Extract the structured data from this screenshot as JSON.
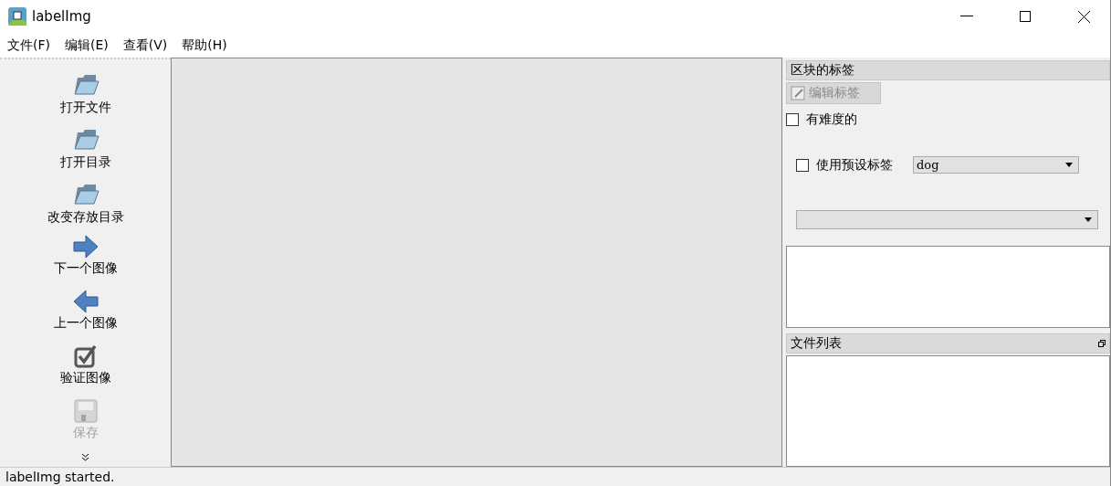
{
  "window": {
    "title": "labelImg"
  },
  "menu": [
    "文件(F)",
    "编辑(E)",
    "查看(V)",
    "帮助(H)"
  ],
  "toolbar": [
    {
      "kind": "folder",
      "label": "打开文件",
      "disabled": false
    },
    {
      "kind": "folder",
      "label": "打开目录",
      "disabled": false
    },
    {
      "kind": "folder",
      "label": "改变存放目录",
      "disabled": false
    },
    {
      "kind": "next",
      "label": "下一个图像",
      "disabled": false
    },
    {
      "kind": "prev",
      "label": "上一个图像",
      "disabled": false
    },
    {
      "kind": "verify",
      "label": "验证图像",
      "disabled": false
    },
    {
      "kind": "save",
      "label": "保存",
      "disabled": true
    }
  ],
  "box_labels": {
    "title": "区块的标签",
    "edit_button": {
      "label": "编辑标签",
      "disabled": true
    },
    "difficult": {
      "label": "有难度的",
      "checked": false
    },
    "default_label": {
      "label": "使用预设标签",
      "checked": false,
      "value": "dog"
    }
  },
  "file_list": {
    "title": "文件列表"
  },
  "status_bar": "labelImg started."
}
